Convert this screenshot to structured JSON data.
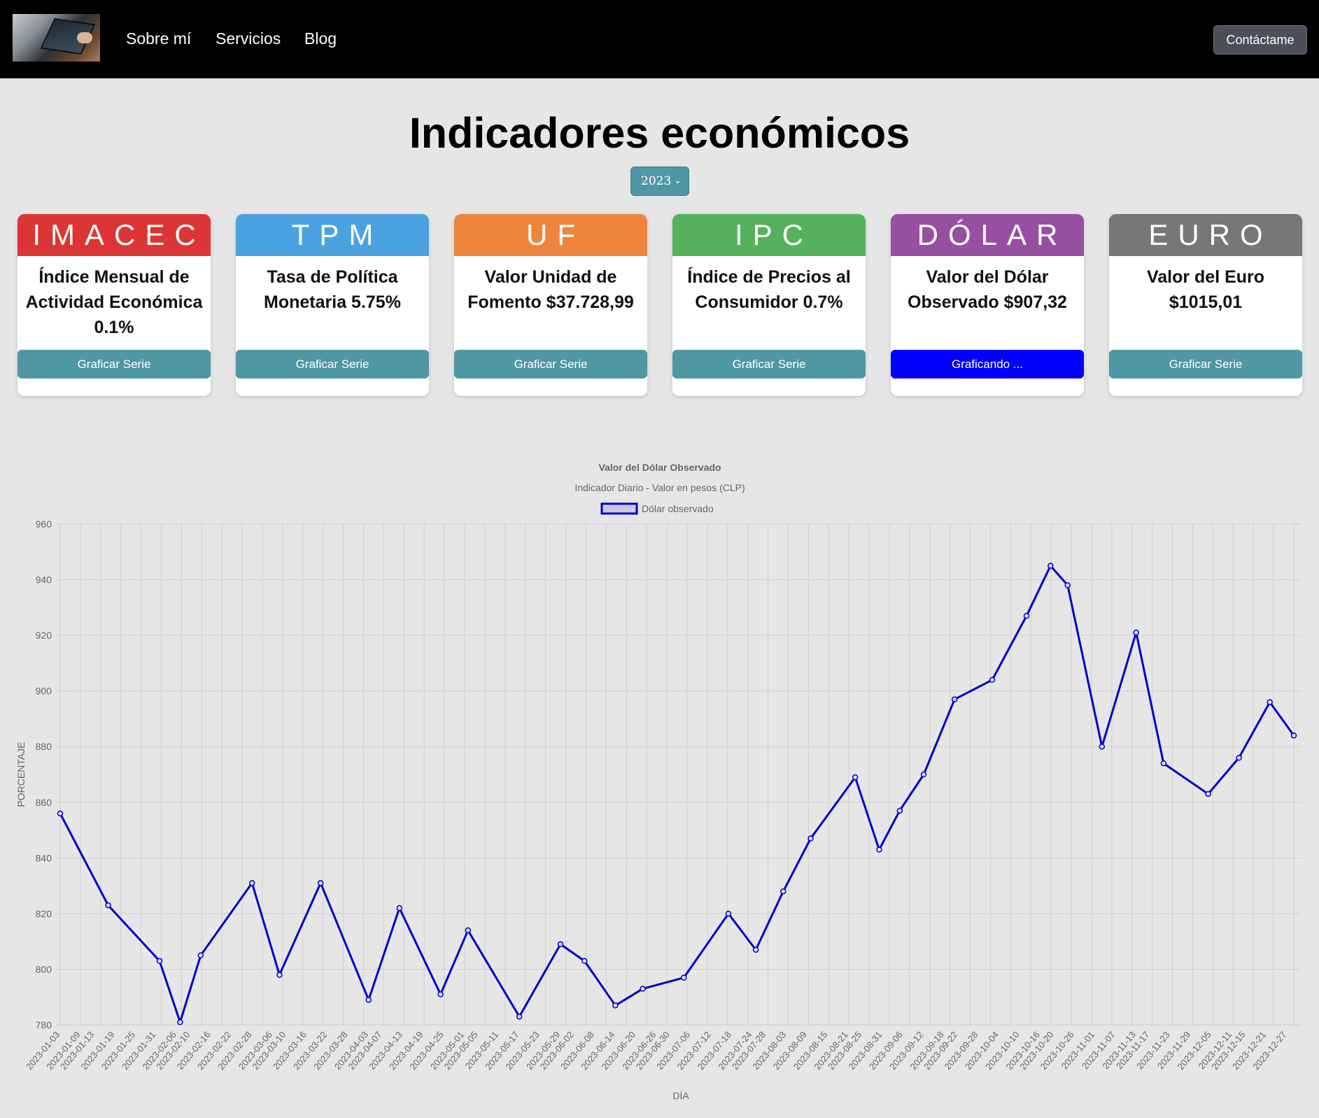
{
  "nav": {
    "links": [
      "Sobre mí",
      "Servicios",
      "Blog"
    ],
    "contact_label": "Contáctame"
  },
  "page": {
    "title": "Indicadores económicos",
    "year": "2023"
  },
  "cards": [
    {
      "code": "IMACEC",
      "color": "#dc3535",
      "description": "Índice Mensual de Actividad Económica 0.1%",
      "button": "Graficar Serie"
    },
    {
      "code": "TPM",
      "color": "#4aa3e0",
      "description": "Tasa de Política Monetaria 5.75%",
      "button": "Graficar Serie"
    },
    {
      "code": "UF",
      "color": "#ef853c",
      "description": "Valor Unidad de Fomento $37.728,99",
      "button": "Graficar Serie"
    },
    {
      "code": "IPC",
      "color": "#56b15c",
      "description": "Índice de Precios al Consumidor 0.7%",
      "button": "Graficar Serie"
    },
    {
      "code": "DÓLAR",
      "color": "#974fa2",
      "description": "Valor del Dólar Observado $907,32",
      "button": "Graficando ..."
    },
    {
      "code": "EURO",
      "color": "#777777",
      "description": "Valor del Euro $1015,01",
      "button": "Graficar Serie"
    }
  ],
  "chart_data": {
    "type": "line",
    "title": "Valor del Dólar Observado",
    "subtitle": "Indicador Diario - Valor en pesos (CLP)",
    "xlabel": "DÍA",
    "ylabel": "PORCENTAJE",
    "ylim": [
      780,
      960
    ],
    "yticks": [
      780,
      800,
      820,
      840,
      860,
      880,
      900,
      920,
      940,
      960
    ],
    "grid": true,
    "legend_position": "top",
    "series": [
      {
        "name": "Dólar observado",
        "color": "#0000cc",
        "x": [
          "2023-01-03",
          "2023-01-17",
          "2023-02-01",
          "2023-02-07",
          "2023-02-13",
          "2023-02-28",
          "2023-03-08",
          "2023-03-20",
          "2023-04-03",
          "2023-04-12",
          "2023-04-24",
          "2023-05-02",
          "2023-05-17",
          "2023-05-29",
          "2023-06-05",
          "2023-06-14",
          "2023-06-22",
          "2023-07-04",
          "2023-07-17",
          "2023-07-25",
          "2023-08-02",
          "2023-08-10",
          "2023-08-23",
          "2023-08-30",
          "2023-09-05",
          "2023-09-12",
          "2023-09-21",
          "2023-10-02",
          "2023-10-12",
          "2023-10-19",
          "2023-10-24",
          "2023-11-03",
          "2023-11-13",
          "2023-11-21",
          "2023-12-04",
          "2023-12-13",
          "2023-12-22",
          "2023-12-29"
        ],
        "y": [
          856,
          823,
          803,
          781,
          805,
          831,
          798,
          831,
          789,
          822,
          791,
          814,
          783,
          809,
          803,
          787,
          793,
          797,
          820,
          807,
          828,
          847,
          869,
          843,
          857,
          870,
          897,
          904,
          927,
          945,
          938,
          880,
          921,
          874,
          863,
          876,
          896,
          884
        ]
      }
    ]
  }
}
